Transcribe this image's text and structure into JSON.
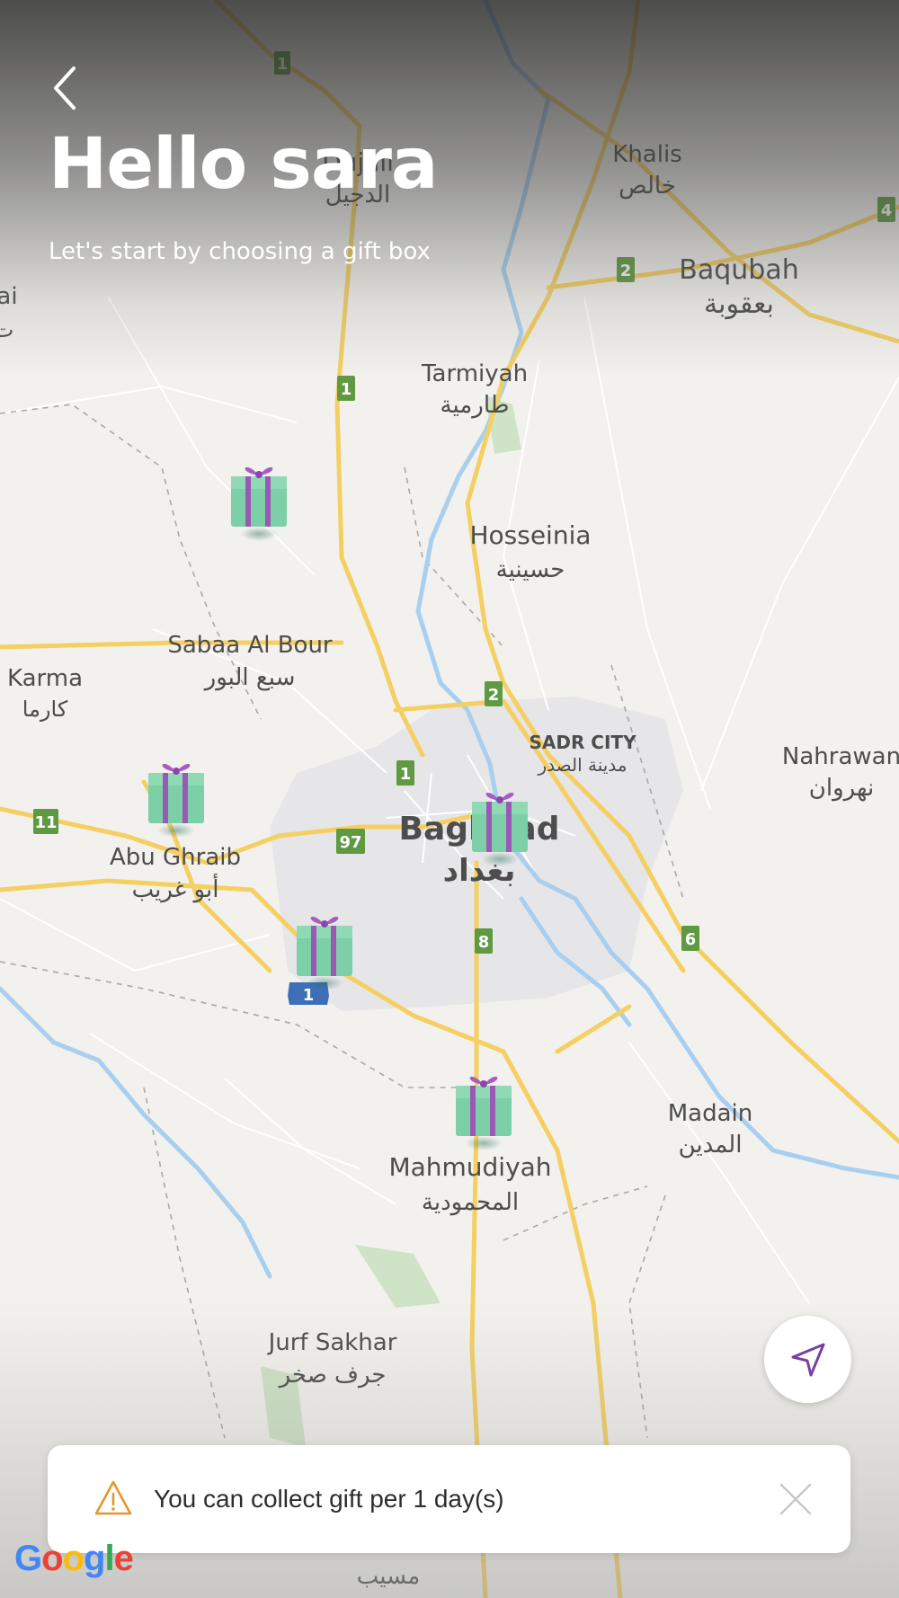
{
  "header": {
    "title": "Hello sara",
    "subtitle": "Let's start by choosing a gift box"
  },
  "map": {
    "places": [
      {
        "en": "Khalis",
        "ar": "خالص"
      },
      {
        "en": "Baqubah",
        "ar": "بعقوبة"
      },
      {
        "en": "Dujail",
        "ar": "الدجيل"
      },
      {
        "en": "Tarmiyah",
        "ar": "طارمية"
      },
      {
        "en": "Hosseinia",
        "ar": "حسينية"
      },
      {
        "en": "Sabaa Al Bour",
        "ar": "سبع البور"
      },
      {
        "en": "Karma",
        "ar": "كارما"
      },
      {
        "en": "Nahrawan",
        "ar": "نهروان"
      },
      {
        "en": "SADR CITY",
        "ar": "مدينة الصدر"
      },
      {
        "en": "Baghdad",
        "ar": "بغداد"
      },
      {
        "en": "Abu Ghraib",
        "ar": "أبو غريب"
      },
      {
        "en": "Madain",
        "ar": "المدين"
      },
      {
        "en": "Mahmudiyah",
        "ar": "المحمودية"
      },
      {
        "en": "Jurf Sakhar",
        "ar": "جرف صخر"
      },
      {
        "en": "",
        "ar": "مسيب"
      }
    ],
    "edge_left_en": "ai",
    "edge_left_ar": "ت",
    "route_shields": [
      "1",
      "1",
      "1",
      "2",
      "2",
      "4",
      "6",
      "8",
      "11",
      "97",
      "1"
    ]
  },
  "gifts": {
    "count": 5,
    "icon": "gift-box-icon"
  },
  "toast": {
    "message": "You can collect gift per 1 day(s)",
    "icon": "warning-icon",
    "close_icon": "close-icon"
  },
  "branding": {
    "google": "Google"
  },
  "colors": {
    "accent": "#7b3fa0",
    "warning": "#e6972b",
    "gift_green": "#7dcfa8",
    "gift_ribbon": "#9b59b6",
    "road_major": "#f7d36b"
  }
}
